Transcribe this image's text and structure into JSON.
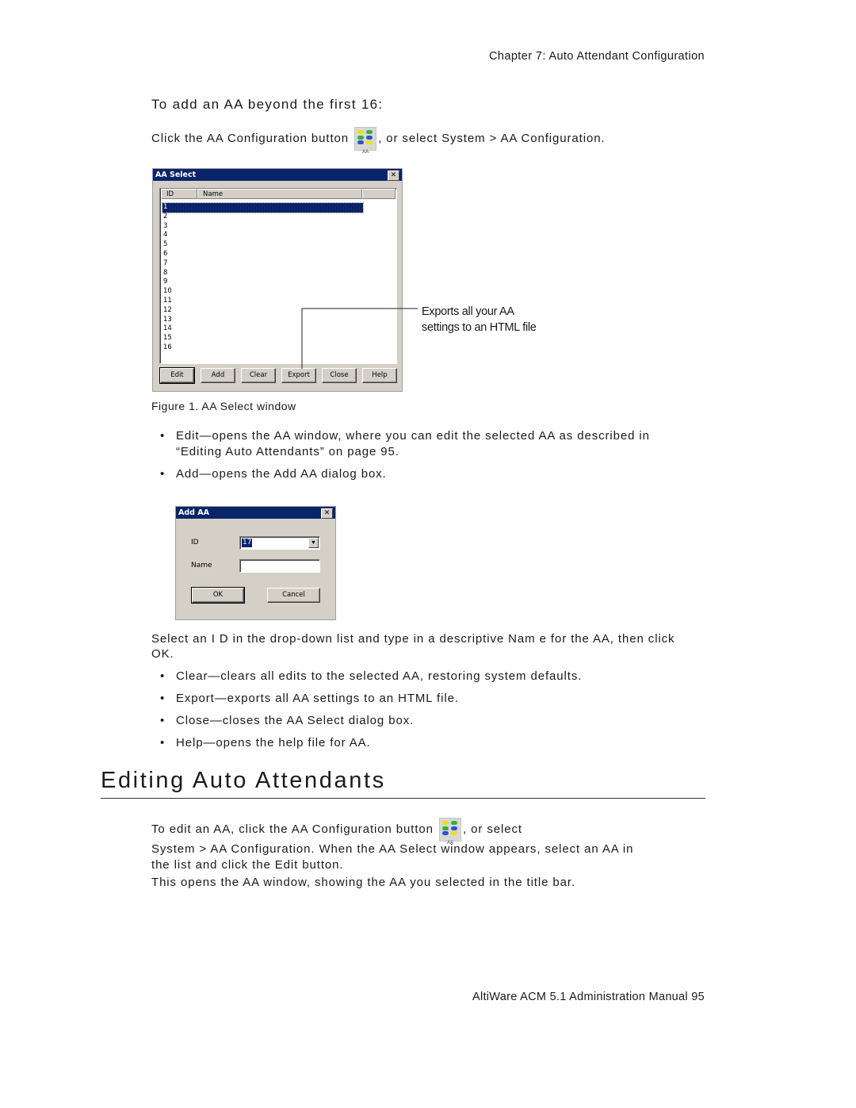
{
  "running_head": "Chapter 7:  Auto Attendant Configuration",
  "section_subhead": "To add an AA beyond the first 16:",
  "intro": {
    "before_icon": "Click the AA Configuration button",
    "after_icon": ", or select System > AA Configuration.",
    "icon_label": "AA"
  },
  "aa_select_window": {
    "title": "AA Select",
    "close_glyph": "✕",
    "columns": [
      "ID",
      "Name",
      ""
    ],
    "rows": [
      "1",
      "2",
      "3",
      "4",
      "5",
      "6",
      "7",
      "8",
      "9",
      "10",
      "11",
      "12",
      "13",
      "14",
      "15",
      "16"
    ],
    "selected_row": "1",
    "buttons": [
      "Edit",
      "Add",
      "Clear",
      "Export",
      "Close",
      "Help"
    ]
  },
  "callout": "Exports all your AA settings to an HTML file",
  "figure_caption": "Figure 1.   AA Select window",
  "bullets_1": [
    {
      "line1": "Edit—opens the AA window, where you can edit the selected AA as described in",
      "line2": "“Editing Auto Attendants” on page 95."
    },
    {
      "line1": "Add—opens the Add AA dialog box.",
      "line2": ""
    }
  ],
  "add_aa_dialog": {
    "title": "Add AA",
    "close_glyph": "✕",
    "id_label": "ID",
    "id_value": "17",
    "name_label": "Name",
    "name_value": "",
    "ok_label": "OK",
    "cancel_label": "Cancel",
    "dropdown_glyph": "▼"
  },
  "select_para": {
    "line1": "Select an I D in the drop-down list and type in a descriptive Nam e for the AA, then click",
    "line2": "OK."
  },
  "bullets_2": [
    "Clear—clears all edits to the selected AA, restoring system defaults.",
    "Export—exports all AA settings to an HTML file.",
    "Close—closes the AA Select dialog box.",
    "Help—opens the help file for AA."
  ],
  "bullet_glyph": "•",
  "heading": "Editing Auto Attendants",
  "edit_para": {
    "line1_before_icon": "To edit an AA, click the AA Configuration button",
    "line1_after_icon": ", or select",
    "line2": "System > AA Configuration. When the AA Select window appears, select an AA in",
    "line3": "the list and click the Edit button."
  },
  "closing_para": "This opens the AA window, showing the AA you selected in the title bar.",
  "footer": "AltiWare ACM 5.1 Administration Manual   95"
}
